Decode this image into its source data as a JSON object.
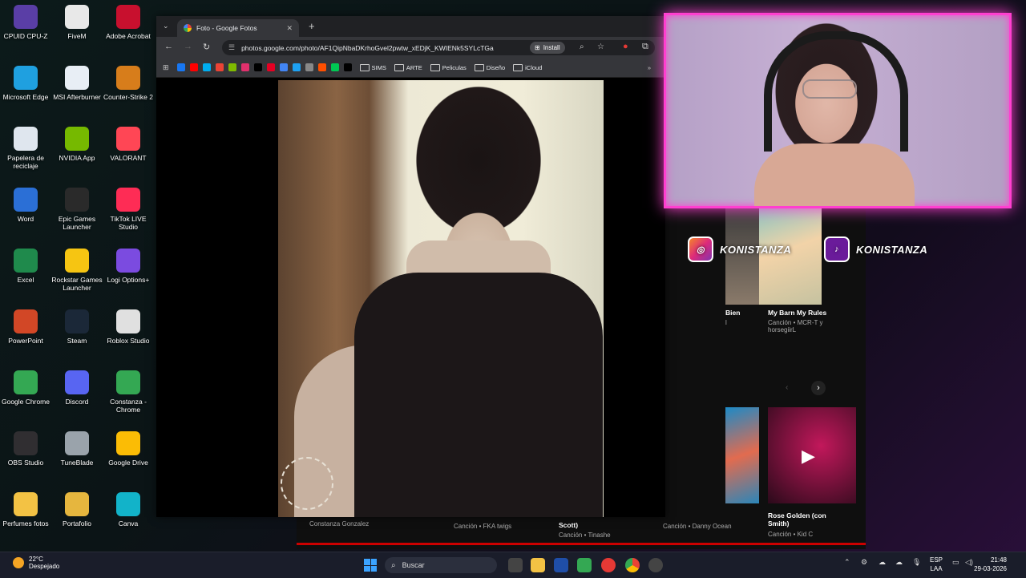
{
  "desktop": {
    "icons": [
      {
        "label": "CPUID CPU-Z",
        "icon": "cpu-z-icon",
        "color": "#5a3ea6"
      },
      {
        "label": "FiveM",
        "icon": "fivem-icon",
        "color": "#e8e8e8"
      },
      {
        "label": "Adobe Acrobat",
        "icon": "acrobat-icon",
        "color": "#c8102e"
      },
      {
        "label": "Microsoft Edge",
        "icon": "edge-icon",
        "color": "#1fa0e0"
      },
      {
        "label": "MSI Afterburner",
        "icon": "afterburner-icon",
        "color": "#e8eef5"
      },
      {
        "label": "Counter-Strike 2",
        "icon": "cs2-icon",
        "color": "#d77d1b"
      },
      {
        "label": "Papelera de reciclaje",
        "icon": "recycle-bin-icon",
        "color": "#dfe6ee"
      },
      {
        "label": "NVIDIA App",
        "icon": "nvidia-icon",
        "color": "#76b900"
      },
      {
        "label": "VALORANT",
        "icon": "valorant-icon",
        "color": "#ff4655"
      },
      {
        "label": "Word",
        "icon": "word-icon",
        "color": "#2b6fd6"
      },
      {
        "label": "Epic Games Launcher",
        "icon": "epic-games-icon",
        "color": "#2a2a2a"
      },
      {
        "label": "TikTok LIVE Studio",
        "icon": "tiktok-live-icon",
        "color": "#fe2c55"
      },
      {
        "label": "Excel",
        "icon": "excel-icon",
        "color": "#1f8a4c"
      },
      {
        "label": "Rockstar Games Launcher",
        "icon": "rockstar-icon",
        "color": "#f6c512"
      },
      {
        "label": "Logi Options+",
        "icon": "logi-icon",
        "color": "#7b4be0"
      },
      {
        "label": "PowerPoint",
        "icon": "powerpoint-icon",
        "color": "#d24726"
      },
      {
        "label": "Steam",
        "icon": "steam-icon",
        "color": "#1b2838"
      },
      {
        "label": "Roblox Studio",
        "icon": "roblox-icon",
        "color": "#e0e0e0"
      },
      {
        "label": "Google Chrome",
        "icon": "chrome-icon",
        "color": "#34a853"
      },
      {
        "label": "Discord",
        "icon": "discord-icon",
        "color": "#5865f2"
      },
      {
        "label": "Constanza - Chrome",
        "icon": "chrome-profile-icon",
        "color": "#34a853"
      },
      {
        "label": "OBS Studio",
        "icon": "obs-icon",
        "color": "#302e31"
      },
      {
        "label": "TuneBlade",
        "icon": "tuneblade-icon",
        "color": "#9aa3ab"
      },
      {
        "label": "Google Drive",
        "icon": "drive-icon",
        "color": "#fbbc05"
      },
      {
        "label": "Perfumes fotos",
        "icon": "folder-icon",
        "color": "#f3c244"
      },
      {
        "label": "Portafolio",
        "icon": "folder-icon",
        "color": "#e6b63e"
      },
      {
        "label": "Canva",
        "icon": "canva-icon",
        "color": "#12b3c9"
      }
    ]
  },
  "browser": {
    "tab_title": "Foto - Google Fotos",
    "url": "photos.google.com/photo/AF1QipNbaDKrhoGvel2pwtw_xEDjK_KWIENk5SYLcTGa",
    "install_label": "Install",
    "bookmarks": [
      {
        "label": "SIMS"
      },
      {
        "label": "ARTE"
      },
      {
        "label": "Peliculas"
      },
      {
        "label": "Diseño"
      },
      {
        "label": "iCloud"
      }
    ],
    "bookmark_icon_colors": [
      "#1877f2",
      "#ff0000",
      "#00adef",
      "#ea4335",
      "#7fba00",
      "#e1306c",
      "#000000",
      "#e60023",
      "#4285f4",
      "#1da1f2",
      "#888888",
      "#ff4f00",
      "#00c853",
      "#000000"
    ]
  },
  "music": {
    "cards": [
      {
        "title": "Bien",
        "subtitle": "l"
      },
      {
        "title": "My Barn My Rules",
        "subtitle": "Canción • MCR-T y horsegiirL"
      },
      {
        "title": "Rose Golden (con Smith)",
        "subtitle": "Canción • Kid C"
      }
    ],
    "bottom": [
      {
        "title": "Constanza Gonzalez",
        "subtitle": ""
      },
      {
        "title": "",
        "subtitle": "Canción • FKA twigs"
      },
      {
        "title": "Scott)",
        "subtitle": "Canción • Tinashe"
      },
      {
        "title": "",
        "subtitle": "Canción • Danny Ocean"
      }
    ]
  },
  "overlay": {
    "social_name_1": "KONISTANZA",
    "social_name_2": "KONISTANZA"
  },
  "taskbar": {
    "temperature": "22°C",
    "weather": "Despejado",
    "search_placeholder": "Buscar",
    "lang_1": "ESP",
    "lang_2": "LAA",
    "time": "21:48",
    "date": "29-03-2026"
  }
}
